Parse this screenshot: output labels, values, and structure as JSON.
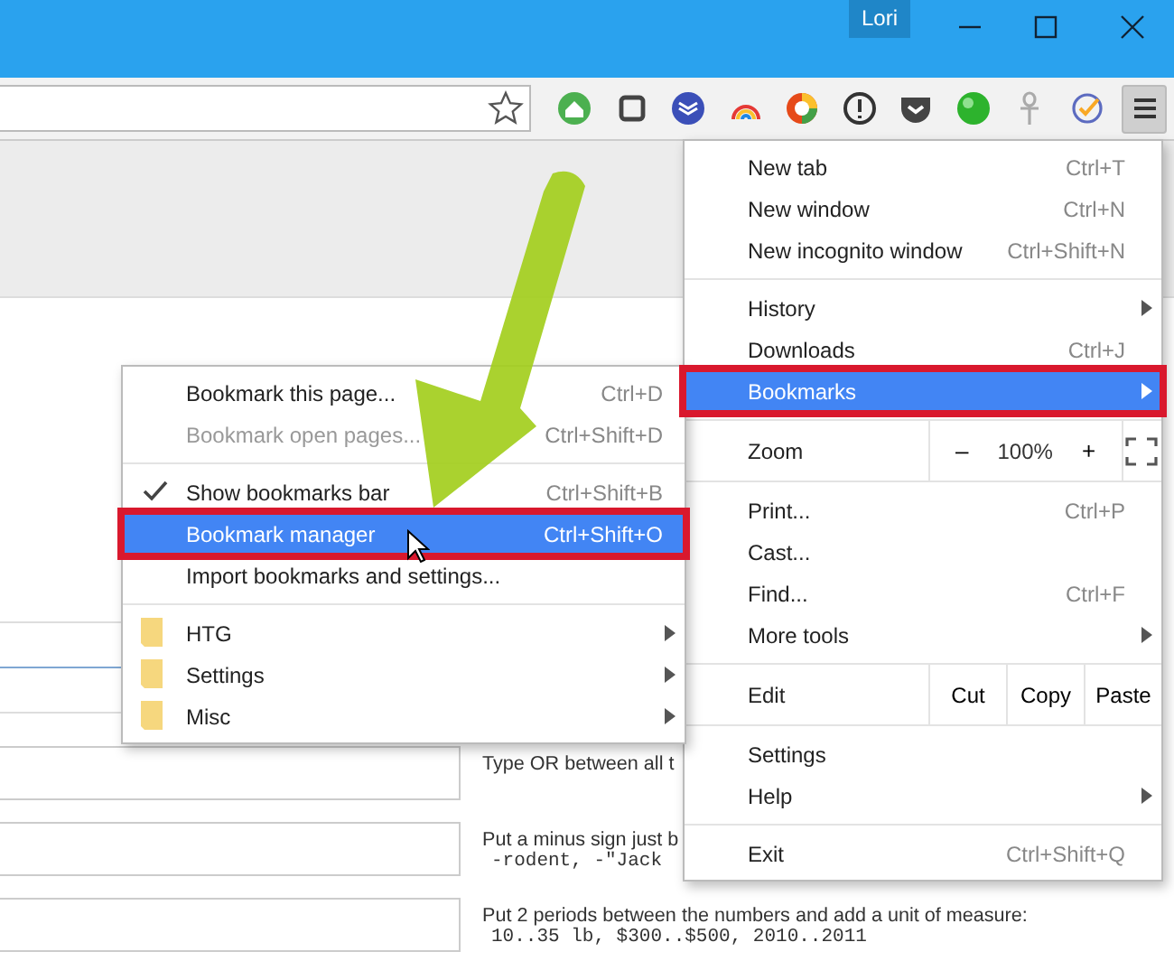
{
  "window": {
    "profile": "Lori"
  },
  "toolbar": {
    "menu_open": true
  },
  "page": {
    "rows": [
      {
        "hint": [
          "Type OR between all t"
        ]
      },
      {
        "hint": [
          "Put a minus sign just b",
          "-rodent, -\"Jack"
        ]
      },
      {
        "hint": [
          "Put 2 periods between the numbers and add a unit of measure:",
          "10..35 lb, $300..$500, 2010..2011"
        ]
      }
    ]
  },
  "main_menu": {
    "items": [
      {
        "kind": "item",
        "label": "New tab",
        "shortcut": "Ctrl+T",
        "submenu": false,
        "selected": false,
        "outlined": false
      },
      {
        "kind": "item",
        "label": "New window",
        "shortcut": "Ctrl+N",
        "submenu": false,
        "selected": false,
        "outlined": false
      },
      {
        "kind": "item",
        "label": "New incognito window",
        "shortcut": "Ctrl+Shift+N",
        "submenu": false,
        "selected": false,
        "outlined": false
      },
      {
        "kind": "divider"
      },
      {
        "kind": "item",
        "label": "History",
        "submenu": true,
        "selected": false,
        "outlined": false
      },
      {
        "kind": "item",
        "label": "Downloads",
        "shortcut": "Ctrl+J",
        "submenu": false,
        "selected": false,
        "outlined": false
      },
      {
        "kind": "item",
        "label": "Bookmarks",
        "submenu": true,
        "selected": true,
        "outlined": true
      },
      {
        "kind": "divider"
      },
      {
        "kind": "zoom",
        "label": "Zoom",
        "minus": "–",
        "value": "100%",
        "plus": "+"
      },
      {
        "kind": "divider"
      },
      {
        "kind": "item",
        "label": "Print...",
        "shortcut": "Ctrl+P",
        "submenu": false,
        "selected": false,
        "outlined": false
      },
      {
        "kind": "item",
        "label": "Cast...",
        "submenu": false,
        "selected": false,
        "outlined": false
      },
      {
        "kind": "item",
        "label": "Find...",
        "shortcut": "Ctrl+F",
        "submenu": false,
        "selected": false,
        "outlined": false
      },
      {
        "kind": "item",
        "label": "More tools",
        "submenu": true,
        "selected": false,
        "outlined": false
      },
      {
        "kind": "divider"
      },
      {
        "kind": "edit",
        "label": "Edit",
        "buttons": [
          "Cut",
          "Copy",
          "Paste"
        ]
      },
      {
        "kind": "divider"
      },
      {
        "kind": "item",
        "label": "Settings",
        "submenu": false,
        "selected": false,
        "outlined": false
      },
      {
        "kind": "item",
        "label": "Help",
        "submenu": true,
        "selected": false,
        "outlined": false
      },
      {
        "kind": "divider"
      },
      {
        "kind": "item",
        "label": "Exit",
        "shortcut": "Ctrl+Shift+Q",
        "submenu": false,
        "selected": false,
        "outlined": false
      }
    ]
  },
  "bookmarks_menu": {
    "items": [
      {
        "kind": "item",
        "label": "Bookmark this page...",
        "shortcut": "Ctrl+D",
        "disabled": false,
        "checked": false,
        "selected": false,
        "outlined": false
      },
      {
        "kind": "item",
        "label": "Bookmark open pages...",
        "shortcut": "Ctrl+Shift+D",
        "disabled": true,
        "checked": false,
        "selected": false,
        "outlined": false
      },
      {
        "kind": "divider"
      },
      {
        "kind": "item",
        "label": "Show bookmarks bar",
        "shortcut": "Ctrl+Shift+B",
        "disabled": false,
        "checked": true,
        "selected": false,
        "outlined": false
      },
      {
        "kind": "item",
        "label": "Bookmark manager",
        "shortcut": "Ctrl+Shift+O",
        "disabled": false,
        "checked": false,
        "selected": true,
        "outlined": true
      },
      {
        "kind": "item",
        "label": "Import bookmarks and settings...",
        "disabled": false,
        "checked": false,
        "selected": false,
        "outlined": false
      },
      {
        "kind": "divider"
      },
      {
        "kind": "folder",
        "label": "HTG"
      },
      {
        "kind": "folder",
        "label": "Settings"
      },
      {
        "kind": "folder",
        "label": "Misc"
      }
    ]
  }
}
